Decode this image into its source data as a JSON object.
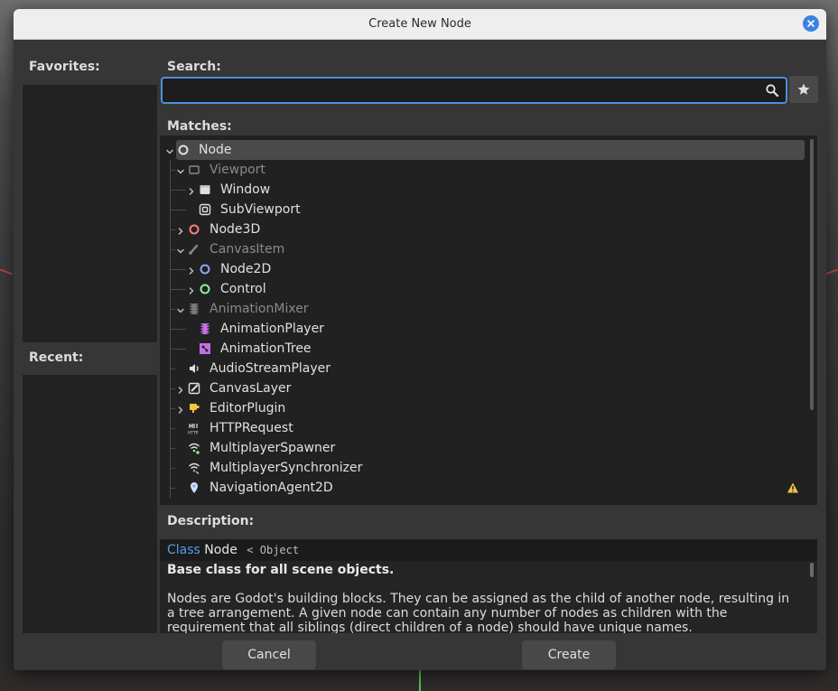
{
  "dialog": {
    "title": "Create New Node"
  },
  "favorites": {
    "label": "Favorites:"
  },
  "recent": {
    "label": "Recent:"
  },
  "search": {
    "label": "Search:",
    "value": "",
    "placeholder": ""
  },
  "matches": {
    "label": "Matches:",
    "tree": [
      {
        "label": "Node",
        "depth": 0,
        "expander": "open",
        "icon": "node-circle-icon",
        "dim": false,
        "selected": true
      },
      {
        "label": "Viewport",
        "depth": 1,
        "expander": "open",
        "icon": "viewport-icon",
        "dim": true
      },
      {
        "label": "Window",
        "depth": 2,
        "expander": "closed",
        "icon": "window-icon",
        "dim": false
      },
      {
        "label": "SubViewport",
        "depth": 2,
        "expander": "none",
        "icon": "subviewport-icon",
        "dim": false
      },
      {
        "label": "Node3D",
        "depth": 1,
        "expander": "closed",
        "icon": "node3d-icon",
        "dim": false
      },
      {
        "label": "CanvasItem",
        "depth": 1,
        "expander": "open",
        "icon": "canvasitem-icon",
        "dim": true
      },
      {
        "label": "Node2D",
        "depth": 2,
        "expander": "closed",
        "icon": "node2d-icon",
        "dim": false
      },
      {
        "label": "Control",
        "depth": 2,
        "expander": "closed",
        "icon": "control-icon",
        "dim": false
      },
      {
        "label": "AnimationMixer",
        "depth": 1,
        "expander": "open",
        "icon": "animationmixer-icon",
        "dim": true
      },
      {
        "label": "AnimationPlayer",
        "depth": 2,
        "expander": "none",
        "icon": "animationplayer-icon",
        "dim": false
      },
      {
        "label": "AnimationTree",
        "depth": 2,
        "expander": "none",
        "icon": "animationtree-icon",
        "dim": false
      },
      {
        "label": "AudioStreamPlayer",
        "depth": 1,
        "expander": "none",
        "icon": "audio-icon",
        "dim": false
      },
      {
        "label": "CanvasLayer",
        "depth": 1,
        "expander": "closed",
        "icon": "canvaslayer-icon",
        "dim": false
      },
      {
        "label": "EditorPlugin",
        "depth": 1,
        "expander": "closed",
        "icon": "editorplugin-icon",
        "dim": false
      },
      {
        "label": "HTTPRequest",
        "depth": 1,
        "expander": "none",
        "icon": "http-icon",
        "dim": false
      },
      {
        "label": "MultiplayerSpawner",
        "depth": 1,
        "expander": "none",
        "icon": "multiplayer-spawner-icon",
        "dim": false
      },
      {
        "label": "MultiplayerSynchronizer",
        "depth": 1,
        "expander": "none",
        "icon": "multiplayer-sync-icon",
        "dim": false
      },
      {
        "label": "NavigationAgent2D",
        "depth": 1,
        "expander": "none",
        "icon": "navagent2d-icon",
        "dim": false,
        "warning": true
      }
    ]
  },
  "description": {
    "label": "Description:",
    "class_keyword": "Class",
    "class_name": "Node",
    "inherits": "< Object",
    "brief": "Base class for all scene objects.",
    "body": "Nodes are Godot's building blocks. They can be assigned as the child of another node, resulting in a tree arrangement. A given node can contain any number of nodes as children with the requirement that all siblings (direct children of a node) should have unique names."
  },
  "buttons": {
    "cancel": "Cancel",
    "create": "Create"
  },
  "colors": {
    "accent": "#4e8fd9",
    "node3d": "#fc7f7f",
    "node2d": "#8da5f3",
    "control": "#8eef97",
    "animation": "#c56fe6",
    "warning": "#f5c542"
  }
}
